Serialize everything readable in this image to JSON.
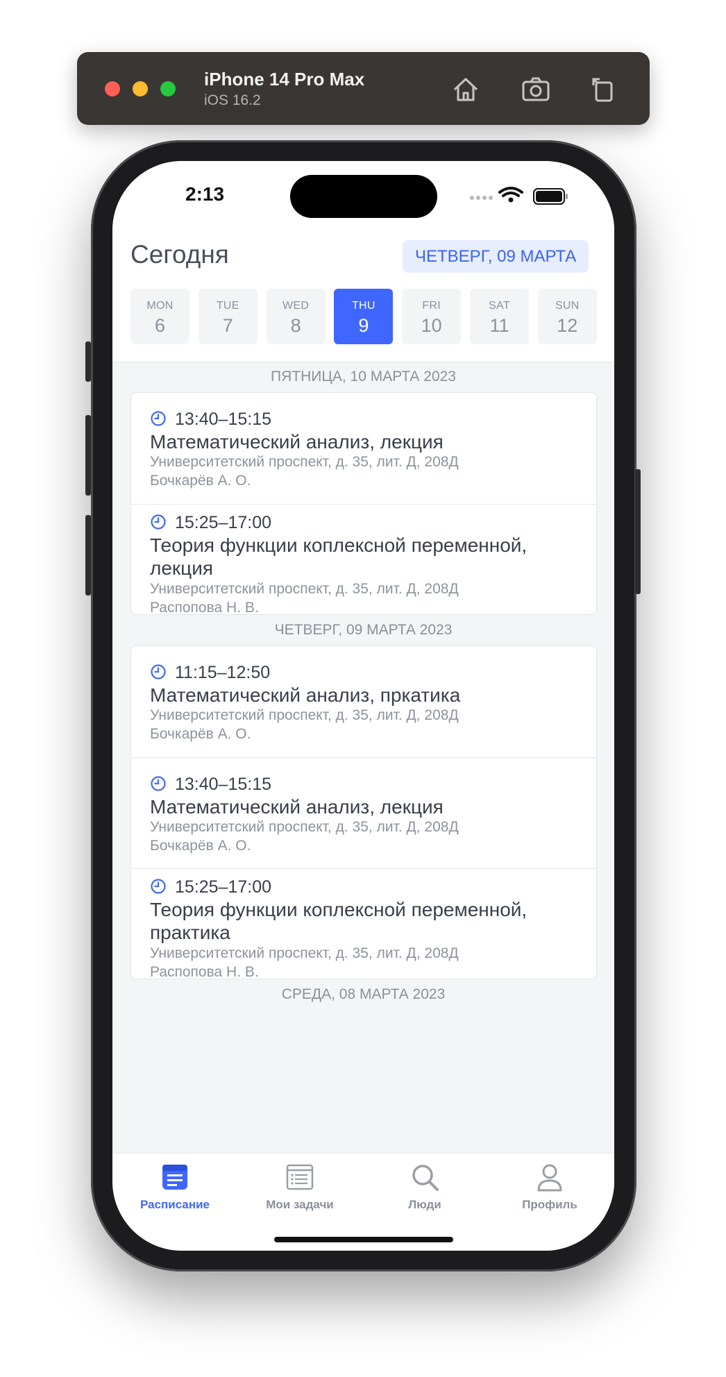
{
  "simulator": {
    "device_name": "iPhone 14 Pro Max",
    "os_version": "iOS 16.2",
    "icons": [
      "home-icon",
      "screenshot-icon",
      "rotate-icon"
    ]
  },
  "status_bar": {
    "time": "2:13"
  },
  "header": {
    "title": "Сегодня",
    "date_chip": "ЧЕТВЕРГ, 09 МАРТА"
  },
  "week": [
    {
      "name": "MON",
      "num": "6"
    },
    {
      "name": "TUE",
      "num": "7"
    },
    {
      "name": "WED",
      "num": "8"
    },
    {
      "name": "THU",
      "num": "9",
      "active": true
    },
    {
      "name": "FRI",
      "num": "10"
    },
    {
      "name": "SAT",
      "num": "11"
    },
    {
      "name": "SUN",
      "num": "12"
    }
  ],
  "sections": [
    {
      "header": "ПЯТНИЦА, 10 МАРТА 2023",
      "lessons": [
        {
          "time": "13:40–15:15",
          "title": "Математический анализ, лекция",
          "address": "Университетский проспект, д. 35, лит. Д, 208Д",
          "teacher": "Бочкарёв А. О."
        },
        {
          "time": "15:25–17:00",
          "title": "Теория функции коплексной переменной, лекция",
          "address": "Университетский проспект, д. 35, лит. Д, 208Д",
          "teacher": "Распопова Н. В."
        }
      ]
    },
    {
      "header": "ЧЕТВЕРГ, 09 МАРТА 2023",
      "lessons": [
        {
          "time": "11:15–12:50",
          "title": "Математический анализ, пркатика",
          "address": "Университетский проспект, д. 35, лит. Д, 208Д",
          "teacher": "Бочкарёв А. О."
        },
        {
          "time": "13:40–15:15",
          "title": "Математический анализ, лекция",
          "address": "Университетский проспект, д. 35, лит. Д, 208Д",
          "teacher": "Бочкарёв А. О."
        },
        {
          "time": "15:25–17:00",
          "title": "Теория функции коплексной переменной, практика",
          "address": "Университетский проспект, д. 35, лит. Д, 208Д",
          "teacher": "Распопова Н. В."
        }
      ]
    },
    {
      "header": "СРЕДА, 08 МАРТА 2023",
      "lessons": []
    }
  ],
  "tabbar": [
    {
      "label": "Расписание",
      "icon": "calendar-icon",
      "active": true
    },
    {
      "label": "Мои задачи",
      "icon": "tasks-icon"
    },
    {
      "label": "Люди",
      "icon": "search-icon"
    },
    {
      "label": "Профиль",
      "icon": "person-icon"
    }
  ],
  "colors": {
    "accent": "#3f66ff",
    "chip_bg": "#e6edff",
    "text": "#3a3e4a",
    "muted": "#8d929c"
  }
}
